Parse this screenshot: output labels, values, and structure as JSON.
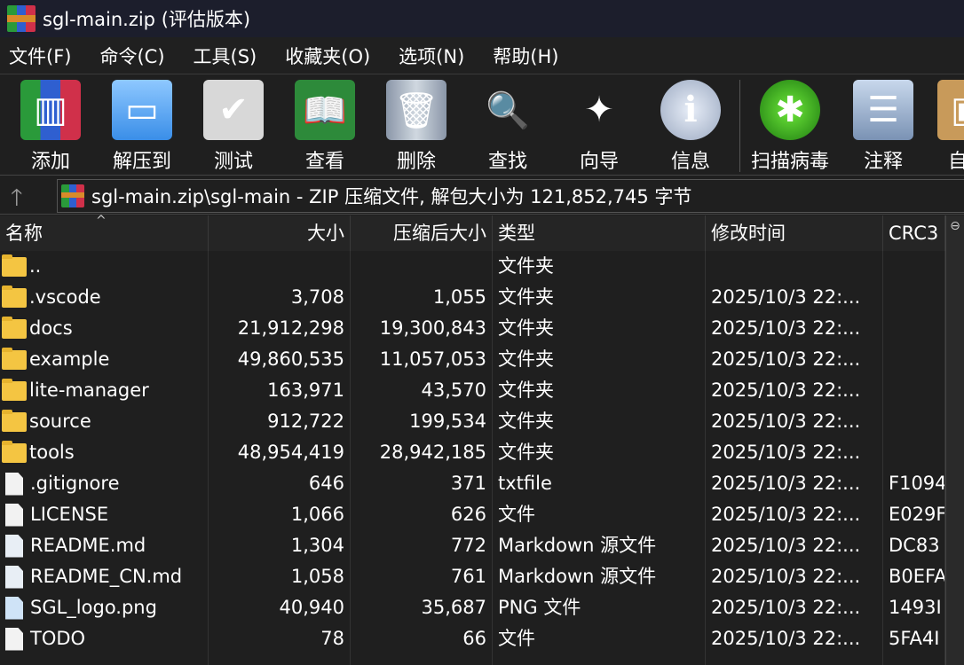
{
  "window": {
    "title": "sgl-main.zip (评估版本)"
  },
  "menu": [
    "文件(F)",
    "命令(C)",
    "工具(S)",
    "收藏夹(O)",
    "选项(N)",
    "帮助(H)"
  ],
  "toolbar": [
    {
      "label": "添加",
      "icon": "add-archive-icon"
    },
    {
      "label": "解压到",
      "icon": "extract-folder-icon"
    },
    {
      "label": "测试",
      "icon": "test-clipboard-icon"
    },
    {
      "label": "查看",
      "icon": "view-book-icon"
    },
    {
      "label": "删除",
      "icon": "trash-icon"
    },
    {
      "label": "查找",
      "icon": "magnifier-icon"
    },
    {
      "label": "向导",
      "icon": "wizard-wand-icon"
    },
    {
      "label": "信息",
      "icon": "info-icon"
    },
    {
      "label": "扫描病毒",
      "icon": "virus-scan-icon"
    },
    {
      "label": "注释",
      "icon": "comment-icon"
    },
    {
      "label": "自解",
      "icon": "sfx-box-icon"
    }
  ],
  "address": {
    "text": "sgl-main.zip\\sgl-main - ZIP 压缩文件, 解包大小为 121,852,745 字节"
  },
  "columns": [
    "名称",
    "大小",
    "压缩后大小",
    "类型",
    "修改时间",
    "CRC3"
  ],
  "rows": [
    {
      "name": "..",
      "size": "",
      "packed": "",
      "type": "文件夹",
      "modified": "",
      "crc": "",
      "kind": "folder"
    },
    {
      "name": ".vscode",
      "size": "3,708",
      "packed": "1,055",
      "type": "文件夹",
      "modified": "2025/10/3 22:...",
      "crc": "",
      "kind": "folder"
    },
    {
      "name": "docs",
      "size": "21,912,298",
      "packed": "19,300,843",
      "type": "文件夹",
      "modified": "2025/10/3 22:...",
      "crc": "",
      "kind": "folder"
    },
    {
      "name": "example",
      "size": "49,860,535",
      "packed": "11,057,053",
      "type": "文件夹",
      "modified": "2025/10/3 22:...",
      "crc": "",
      "kind": "folder"
    },
    {
      "name": "lite-manager",
      "size": "163,971",
      "packed": "43,570",
      "type": "文件夹",
      "modified": "2025/10/3 22:...",
      "crc": "",
      "kind": "folder"
    },
    {
      "name": "source",
      "size": "912,722",
      "packed": "199,534",
      "type": "文件夹",
      "modified": "2025/10/3 22:...",
      "crc": "",
      "kind": "folder"
    },
    {
      "name": "tools",
      "size": "48,954,419",
      "packed": "28,942,185",
      "type": "文件夹",
      "modified": "2025/10/3 22:...",
      "crc": "",
      "kind": "folder"
    },
    {
      "name": ".gitignore",
      "size": "646",
      "packed": "371",
      "type": "txtfile",
      "modified": "2025/10/3 22:...",
      "crc": "F1094",
      "kind": "file"
    },
    {
      "name": "LICENSE",
      "size": "1,066",
      "packed": "626",
      "type": "文件",
      "modified": "2025/10/3 22:...",
      "crc": "E029F",
      "kind": "file"
    },
    {
      "name": "README.md",
      "size": "1,304",
      "packed": "772",
      "type": "Markdown 源文件",
      "modified": "2025/10/3 22:...",
      "crc": "DC83",
      "kind": "md"
    },
    {
      "name": "README_CN.md",
      "size": "1,058",
      "packed": "761",
      "type": "Markdown 源文件",
      "modified": "2025/10/3 22:...",
      "crc": "B0EFA",
      "kind": "md"
    },
    {
      "name": "SGL_logo.png",
      "size": "40,940",
      "packed": "35,687",
      "type": "PNG 文件",
      "modified": "2025/10/3 22:...",
      "crc": "1493I",
      "kind": "png"
    },
    {
      "name": "TODO",
      "size": "78",
      "packed": "66",
      "type": "文件",
      "modified": "2025/10/3 22:...",
      "crc": "5FA4I",
      "kind": "file"
    }
  ]
}
